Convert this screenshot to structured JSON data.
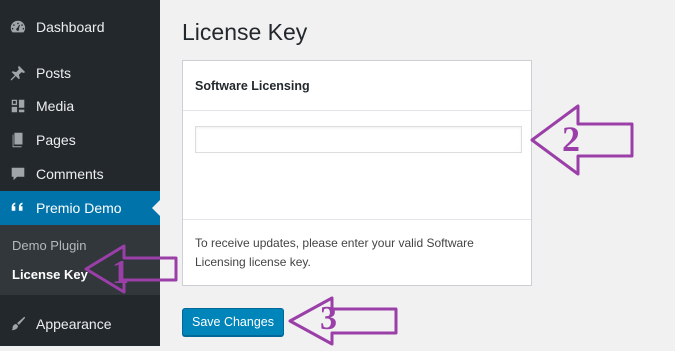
{
  "sidebar": {
    "items": [
      {
        "label": "Dashboard",
        "icon": "dashboard-icon"
      },
      {
        "label": "Posts",
        "icon": "pin-icon"
      },
      {
        "label": "Media",
        "icon": "media-icon"
      },
      {
        "label": "Pages",
        "icon": "pages-icon"
      },
      {
        "label": "Comments",
        "icon": "comment-icon"
      },
      {
        "label": "Premio Demo",
        "icon": "quote-icon",
        "current": true
      },
      {
        "label": "Appearance",
        "icon": "brush-icon"
      }
    ],
    "submenu": [
      {
        "label": "Demo Plugin"
      },
      {
        "label": "License Key",
        "active": true
      }
    ]
  },
  "main": {
    "title": "License Key",
    "box_title": "Software Licensing",
    "license_input": {
      "value": "",
      "placeholder": ""
    },
    "help_text": "To receive updates, please enter your valid Software Licensing license key.",
    "save_label": "Save Changes"
  },
  "annotations": {
    "color": "#9b3fa8",
    "labels": [
      "1",
      "2",
      "3"
    ]
  },
  "colors": {
    "sidebar_bg": "#23282d",
    "submenu_bg": "#32373c",
    "accent": "#0073aa",
    "button": "#0085ba",
    "page_bg": "#f1f1f1"
  }
}
